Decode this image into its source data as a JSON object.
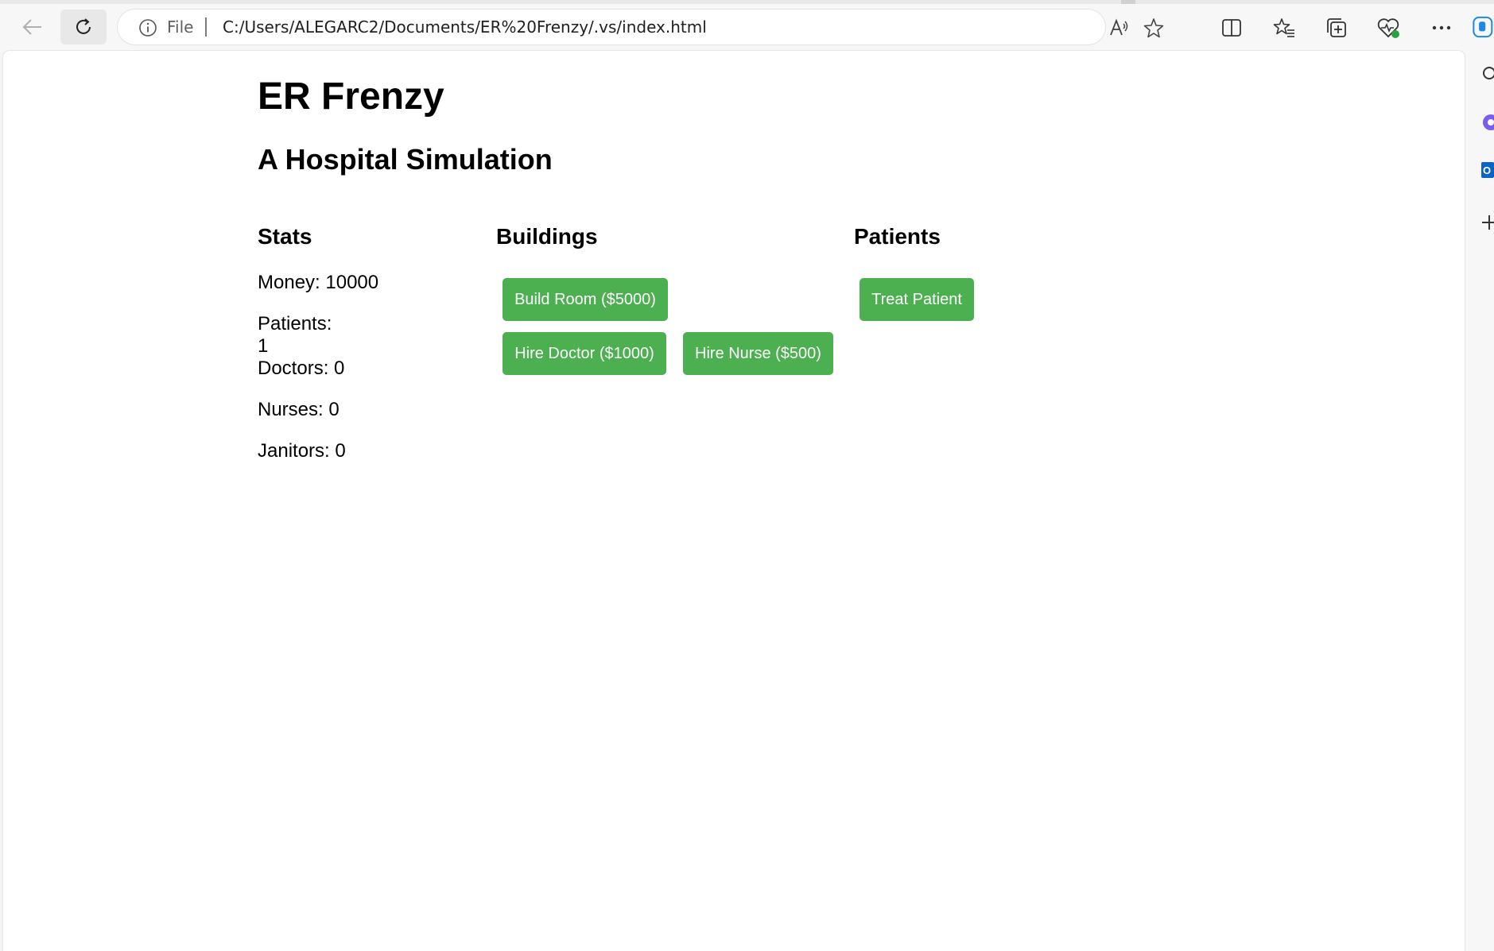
{
  "browser": {
    "scheme_label": "File",
    "url": "C:/Users/ALEGARC2/Documents/ER%20Frenzy/.vs/index.html"
  },
  "page": {
    "title": "ER Frenzy",
    "subtitle": "A Hospital Simulation",
    "stats": {
      "heading": "Stats",
      "money": "Money: 10000",
      "patients_label": "Patients:",
      "patients_value": "1",
      "doctors": "Doctors: 0",
      "nurses": "Nurses: 0",
      "janitors": "Janitors: 0"
    },
    "buildings": {
      "heading": "Buildings",
      "build_room": "Build Room ($5000)",
      "hire_doctor": "Hire Doctor ($1000)",
      "hire_nurse": "Hire Nurse ($500)"
    },
    "patients": {
      "heading": "Patients",
      "treat_patient": "Treat Patient"
    },
    "button_color": "#4caf50"
  }
}
